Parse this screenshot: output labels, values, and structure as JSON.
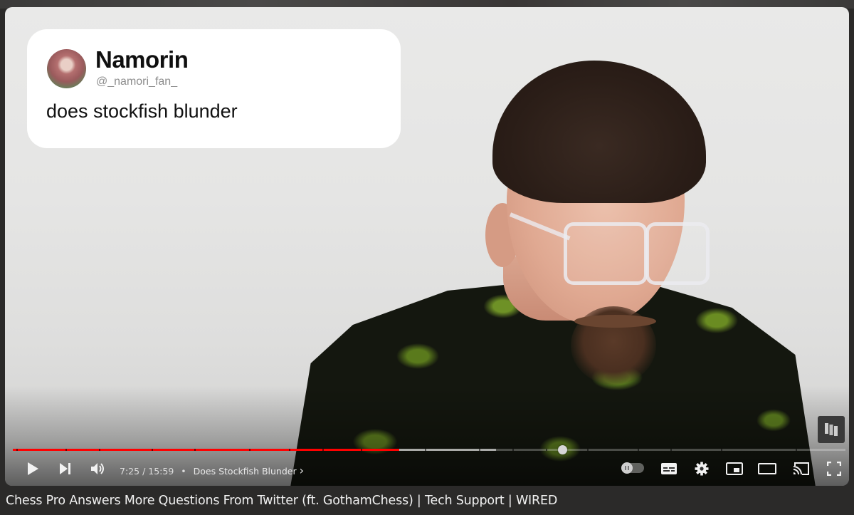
{
  "video": {
    "title": "Chess Pro Answers More Questions From Twitter (ft. GothamChess) | Tech Support | WIRED",
    "watermark": "wired-logo",
    "overlay_tweet": {
      "name": "Namorin",
      "handle": "@_namori_fan_",
      "text": "does stockfish blunder",
      "avatar": "anime-avatar"
    }
  },
  "player": {
    "current_time": "7:25",
    "duration": "15:59",
    "time_separator": "/",
    "chapter_bullet": "•",
    "chapter_title": "Does Stockfish Blunder",
    "chapter_chevron": "›",
    "played_fraction": 0.464,
    "buffered_fraction": 0.58,
    "hover_fraction": 0.66,
    "chapter_marks": [
      0.004,
      0.063,
      0.103,
      0.167,
      0.218,
      0.284,
      0.332,
      0.372,
      0.418,
      0.495,
      0.56,
      0.6,
      0.64,
      0.69,
      0.75,
      0.79,
      0.85,
      0.94
    ],
    "colors": {
      "played": "#ff0000",
      "buffered": "#e6e6e6",
      "track": "#8a8a8a"
    },
    "controls": {
      "play": "play-icon",
      "next": "next-icon",
      "volume": "volume-icon",
      "autoplay": "autoplay-toggle-icon",
      "subtitles": "subtitles-icon",
      "settings": "gear-icon",
      "miniplayer": "miniplayer-icon",
      "theater": "theater-mode-icon",
      "cast": "cast-icon",
      "fullscreen": "fullscreen-icon"
    }
  }
}
